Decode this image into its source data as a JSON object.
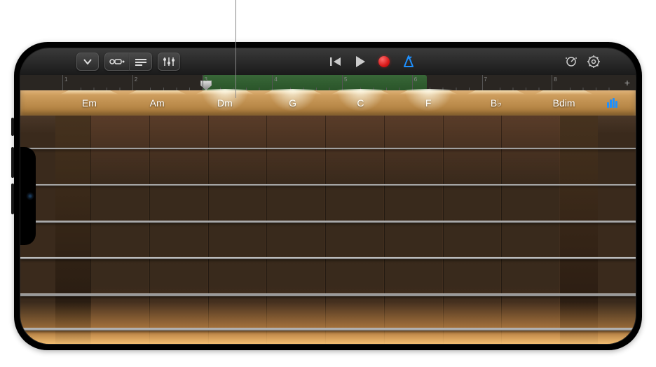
{
  "toolbar": {
    "browser_icon": "chevron-down",
    "tracks_view_icon": "tracks-view",
    "fx_icon": "fx",
    "mixer_icon": "mixer",
    "previous_icon": "previous",
    "play_icon": "play",
    "record_icon": "record",
    "metronome_icon": "metronome",
    "master_effects_icon": "master-effects",
    "settings_icon": "settings",
    "metronome_color": "#1e90ff",
    "record_color": "#e03030"
  },
  "ruler": {
    "bars": [
      "1",
      "2",
      "3",
      "4",
      "5",
      "6",
      "7",
      "8"
    ],
    "region_start_bar": 3,
    "region_end_bar": 6.2,
    "playhead_bar": 3.05,
    "plus_label": "+"
  },
  "chords": {
    "items": [
      {
        "label": "Em",
        "bright": false
      },
      {
        "label": "Am",
        "bright": false
      },
      {
        "label": "Dm",
        "bright": true
      },
      {
        "label": "G",
        "bright": true
      },
      {
        "label": "C",
        "bright": true
      },
      {
        "label": "F",
        "bright": true
      },
      {
        "label": "B♭",
        "bright": false
      },
      {
        "label": "Bdim",
        "bright": false
      }
    ],
    "autoplay_icon": "autoplay",
    "autoplay_color": "#1e90ff"
  },
  "fretboard": {
    "string_count": 6,
    "fret_columns": 8
  }
}
